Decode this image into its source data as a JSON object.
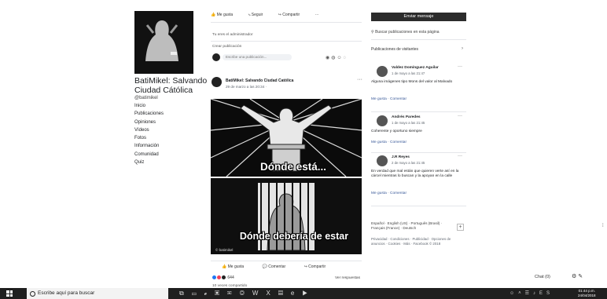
{
  "page": {
    "name": "BatiMikel: Salvando Ciudad Cátólica",
    "handle": "@batimikel",
    "nav": [
      "Inicio",
      "Publicaciones",
      "Opiniones",
      "Vídeos",
      "Fotos",
      "Información",
      "Comunidad",
      "Quiz"
    ]
  },
  "action_bar": {
    "like": "Me gusta",
    "follow": "Seguir",
    "share": "Compartir",
    "more": "···"
  },
  "feed": {
    "section_label": "Tu eres el administrador",
    "composer_hint": "Crear publicación",
    "composer_placeholder": "Escribe una publicación...",
    "post": {
      "author": "BatiMikel: Salvando Ciudad Católica",
      "date": "29 de marzo a las 20:34 · ",
      "more": "···",
      "caption_top": "Dónde está...",
      "caption_bottom": "Dónde debería de estar",
      "watermark": "© batimikel",
      "like": "Me gusta",
      "comment": "Comentar",
      "share": "Compartir",
      "reactions": "644",
      "more_answers": "Ver respuestas"
    },
    "footer_muted": "10 veces compartido"
  },
  "sidebar": {
    "send_message": "Enviar mensaje",
    "search_placeholder": "Buscar publicaciones en esta página",
    "section_title": "Publicaciones de visitantes",
    "chevron": "›",
    "comments": [
      {
        "name": "Valdez Domínguez Aguilar",
        "time": "1 de mayo a las 21:47",
        "text": "Alguna imágenes tipo Mons del valor al Malvado",
        "actions": "Me gusta · Comentar"
      },
      {
        "name": "Andrés Paredes",
        "time": "1 de mayo a las 21:45",
        "text": "Coherente y oportuno siempre",
        "actions": "Me gusta · Comentar"
      },
      {
        "name": "J.R Reyes",
        "time": "2 de mayo a las 21:45",
        "text": "En verdad que mal están que quieren verte así en la cárcel mientras lo buscan y la apoyan en la calle",
        "actions": "Me gusta · Comentar"
      }
    ],
    "languages": "Español · English (US) · Português (Brasil) · Français (France) · Deutsch",
    "plus": "+",
    "footer": "Privacidad · Condiciones · Publicidad · Opciones de anuncios · Cookies · Más · Facebook © 2018"
  },
  "chat": {
    "label": "Chat (0)"
  },
  "taskbar": {
    "search_placeholder": "Escribe aquí para buscar",
    "clock_time": "01:44 p.m.",
    "clock_date": "24/04/2018"
  }
}
